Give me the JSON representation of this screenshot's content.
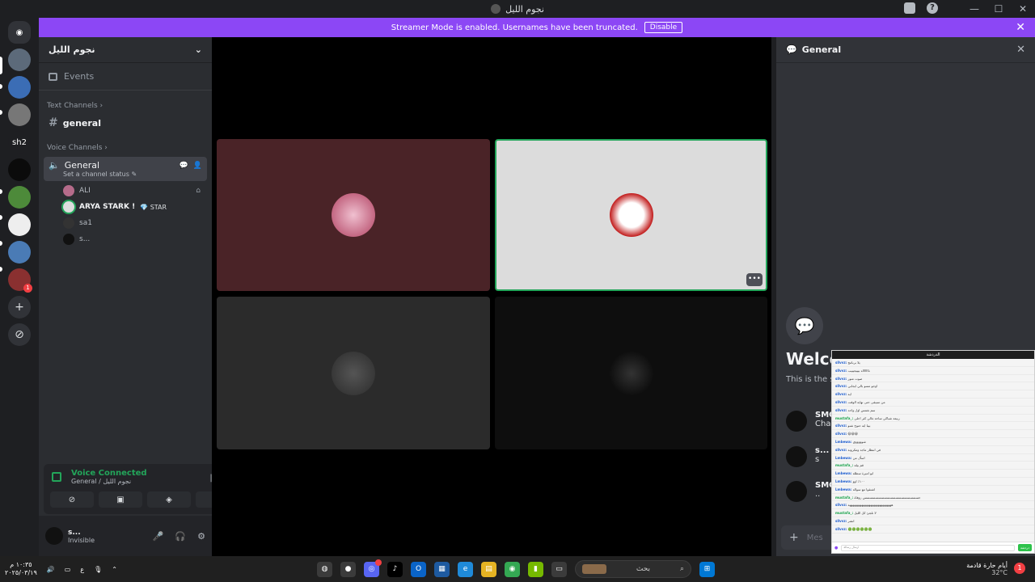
{
  "window": {
    "title": "نجوم الليل",
    "controls": [
      "—",
      "☐",
      "✕"
    ]
  },
  "banner": {
    "text": "Streamer Mode is enabled. Usernames have been truncated.",
    "button": "Disable",
    "close": "✕"
  },
  "guilds": {
    "home": "◉",
    "items": [
      {
        "label": ""
      },
      {
        "label": ""
      },
      {
        "label": ""
      },
      {
        "label": "sh2"
      },
      {
        "label": ""
      },
      {
        "label": ""
      },
      {
        "label": ""
      },
      {
        "label": ""
      },
      {
        "label": "",
        "badge": "1"
      }
    ],
    "add": "+",
    "explore": "⊘"
  },
  "sidebar": {
    "server_name": "نجوم الليل",
    "events": "Events",
    "text_category": "Text Channels ›",
    "text_channels": [
      {
        "name": "general"
      }
    ],
    "voice_category": "Voice Channels ›",
    "voice_channel": {
      "name": "General",
      "status_placeholder": "Set a channel status ✎"
    },
    "members": [
      {
        "name": "ALI",
        "tag": "",
        "extra": "⌂"
      },
      {
        "name": "ARYA STARK !",
        "tag": "💎 STAR",
        "extra": ""
      },
      {
        "name": "sa1",
        "tag": "",
        "extra": ""
      },
      {
        "name": "s...",
        "tag": "",
        "extra": ""
      }
    ]
  },
  "voice_panel": {
    "status": "Voice Connected",
    "location": "General / نجوم الليل",
    "buttons": [
      "⊘",
      "▣",
      "◈",
      "✦"
    ]
  },
  "user_panel": {
    "name": "s...",
    "status": "Invisible",
    "controls": [
      "🎤",
      "🎧",
      "⚙"
    ]
  },
  "stage": {
    "more_button": "•••"
  },
  "chat": {
    "channel": "General",
    "welcome_title": "Welco",
    "welcome_sub": "This is the st",
    "messages": [
      {
        "name": "SMC",
        "text": "Cha"
      },
      {
        "name": "s...",
        "text": "s"
      },
      {
        "name": "SMC",
        "text": ".."
      }
    ],
    "input_placeholder": "Mes"
  },
  "overlay": {
    "title": "الدردشة",
    "lines": [
      {
        "user": "sllvvz:",
        "text": "يلا برنامج"
      },
      {
        "user": "sllvvz:",
        "text": "ناااااااه بيييجيييب"
      },
      {
        "user": "sllvvz:",
        "text": "صوت منور"
      },
      {
        "user": "sllvvz:",
        "text": "اوجو مسو بالي ايجابي"
      },
      {
        "user": "sllvvz:",
        "text": "ايه"
      },
      {
        "user": "sllvvz:",
        "text": "من سيبقى حتى نهاية الوقت"
      },
      {
        "user": "sllvvz:",
        "text": "سم نغمس اول واحد"
      },
      {
        "user": "mustafa_:",
        "text": "ربيعة شباكي ساحة غالي كثر احلى"
      },
      {
        "user": "sllvvz:",
        "text": "بيبا ايه حنوح شنو"
      },
      {
        "user": "sllvvz:",
        "text": "😀😀😀"
      },
      {
        "user": "Lmbewa:",
        "text": "شوووووي"
      },
      {
        "user": "sllvvz:",
        "text": "في انتظار ماجد ومكرونة"
      },
      {
        "user": "Lmbewa:",
        "text": "اسأل من"
      },
      {
        "user": "mustafa_:",
        "text": "قم بيلة"
      },
      {
        "user": "Lmbewa:",
        "text": "ابو اميرة سطله"
      },
      {
        "user": "Lmbewa:",
        "text": "١٠٠٪ اوو"
      },
      {
        "user": "Lmbewa:",
        "text": "اشتقوا مع سوالة"
      },
      {
        "user": "mustafa_:",
        "text": "حسسسسسسسسسسسسسسسسسسس زوفاة"
      },
      {
        "user": "sllvvz:",
        "text": "هههههههههههههههههههههههههههههه"
      },
      {
        "user": "mustafa_:",
        "text": "لا نلجئ كل الليل"
      },
      {
        "user": "sllvvz:",
        "text": "انشر"
      },
      {
        "user": "sllvvz:",
        "text": "🟢🟢🟢🟢🟢🟢"
      }
    ],
    "send": "دردشة",
    "input_placeholder": "ارسال رسالة"
  },
  "taskbar": {
    "time": "١٠:٣٥ م",
    "date": "٢٠٢٥/٠٣/١٩",
    "lang": "ع",
    "search_placeholder": "بحث",
    "weather": "أيام حارة قادمة",
    "temp": "32°C",
    "weather_badge": "1",
    "apps": [
      "◍",
      "●",
      "◎",
      "♪",
      "O",
      "▦",
      "e",
      "▤",
      "◉",
      "▮",
      "▭"
    ]
  },
  "colors": {
    "accent": "#8c47f5",
    "voice_green": "#23a55a",
    "danger": "#f23f43"
  }
}
